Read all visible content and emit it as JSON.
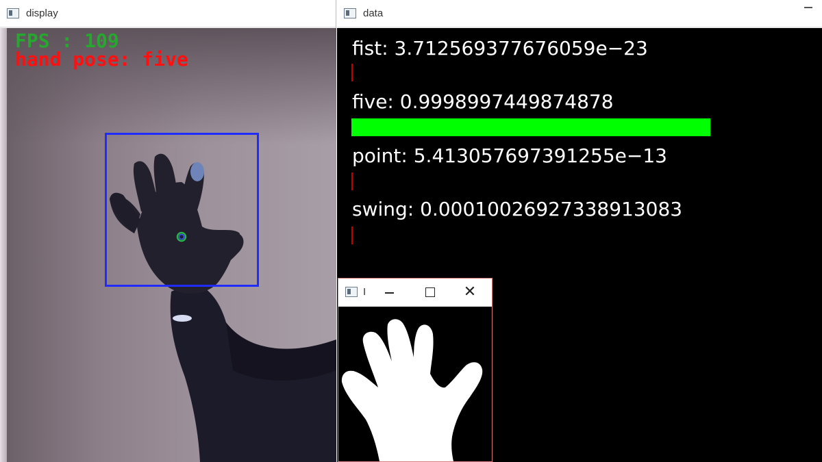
{
  "windows": {
    "display": {
      "title": "display"
    },
    "data": {
      "title": "data"
    },
    "mask": {
      "title": "I",
      "close_glyph": "✕"
    }
  },
  "display": {
    "fps_text": "FPS : 109",
    "pose_text": "hand pose: five",
    "fps_color": "#27a72f",
    "pose_color": "#ff1010",
    "bbox_color": "#1f2bff"
  },
  "data": {
    "bar_color": "#00ff00",
    "classes": [
      {
        "label": "fist:  3.712569377676059e−23",
        "probability": 3.712569377676059e-23
      },
      {
        "label": "five:  0.9998997449874878",
        "probability": 0.9998997449874878
      },
      {
        "label": "point:  5.413057697391255e−13",
        "probability": 5.413057697391255e-13
      },
      {
        "label": "swing:  0.00010026927338913083",
        "probability": 0.00010026927338913083
      }
    ]
  }
}
